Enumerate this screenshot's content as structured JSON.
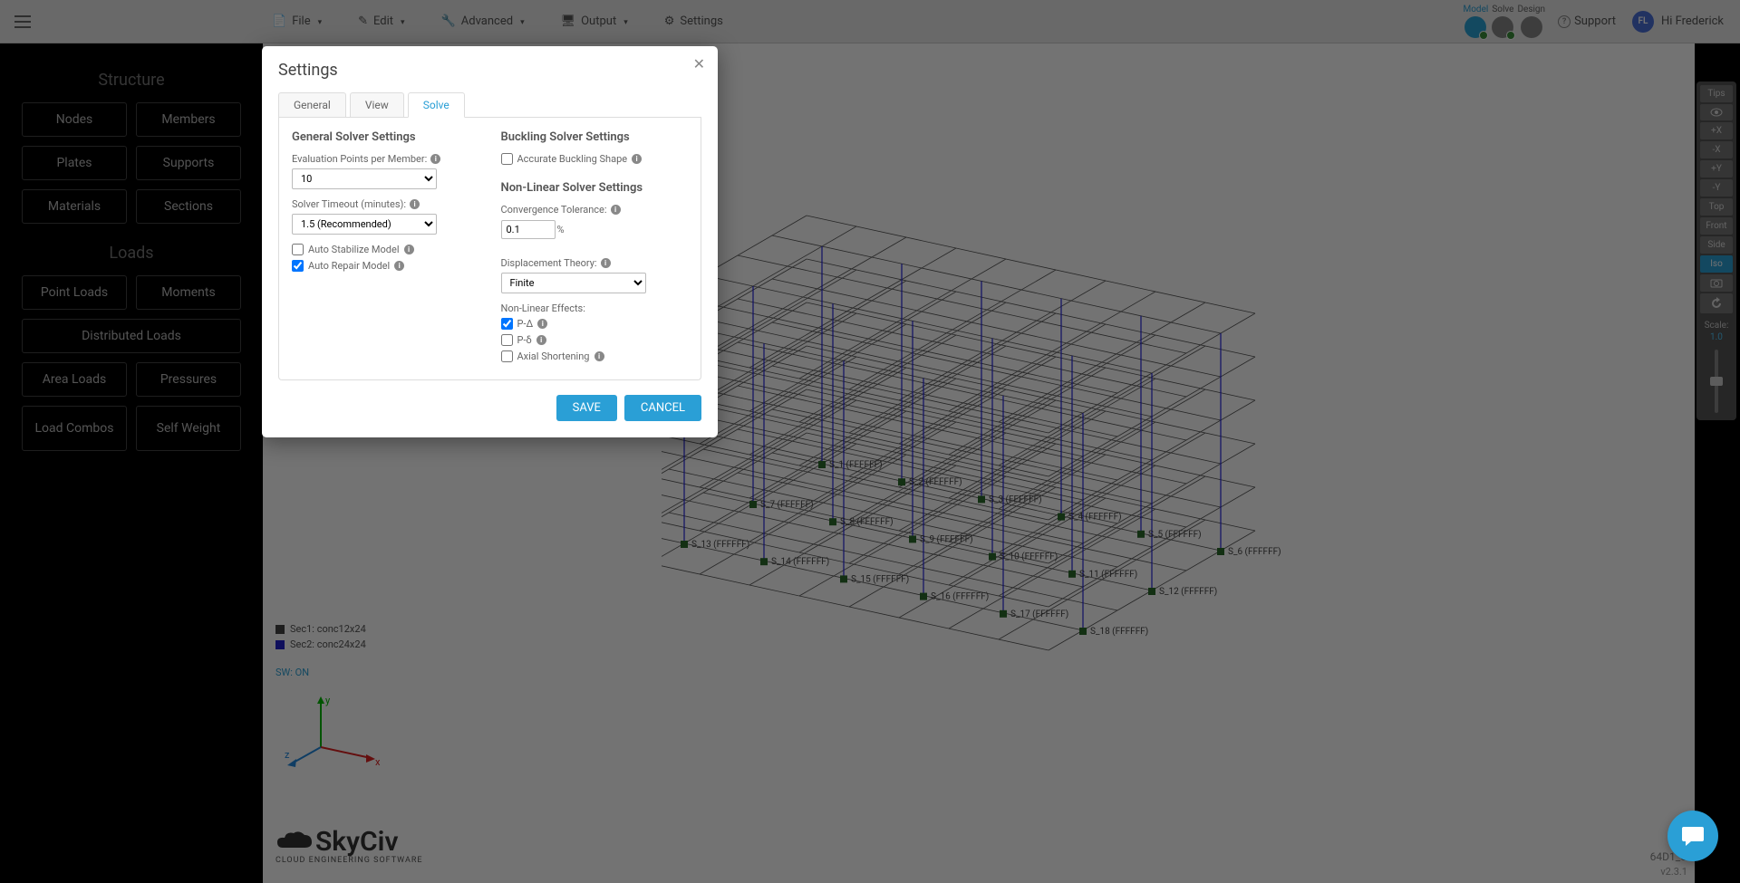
{
  "toolbar": {
    "menus": {
      "file": "File",
      "edit": "Edit",
      "advanced": "Advanced",
      "output": "Output",
      "settings": "Settings"
    },
    "modes": {
      "model": "Model",
      "solve": "Solve",
      "design": "Design"
    },
    "support": "Support",
    "user_greeting": "Hi Frederick",
    "user_initials": "FL"
  },
  "sidebar": {
    "structure_heading": "Structure",
    "loads_heading": "Loads",
    "structure_buttons": [
      "Nodes",
      "Members",
      "Plates",
      "Supports",
      "Materials",
      "Sections"
    ],
    "loads_buttons_row1": [
      "Point Loads",
      "Moments"
    ],
    "loads_distributed": "Distributed Loads",
    "loads_row3": [
      "Area Loads",
      "Pressures"
    ],
    "loads_row4": [
      "Load Combos",
      "Self Weight"
    ]
  },
  "view_controls": {
    "buttons": [
      "Tips",
      "+X",
      "-X",
      "+Y",
      "-Y",
      "Top",
      "Front",
      "Side",
      "Iso"
    ],
    "scale_label": "Scale:",
    "scale_value": "1.0"
  },
  "viewport": {
    "legend": [
      {
        "color": "#444444",
        "label": "Sec1: conc12x24"
      },
      {
        "color": "#2222cc",
        "label": "Sec2: conc24x24"
      }
    ],
    "sw_status": "SW: ON",
    "axes": {
      "x": "x",
      "y": "y",
      "z": "z"
    },
    "logo_text": "SkyCiv",
    "logo_sub": "CLOUD ENGINEERING SOFTWARE",
    "version": "v2.3.1",
    "project_id": "64D1_C",
    "node_labels": [
      "S_1 (FFFFFF)",
      "S_2 (FFFFFF)",
      "S_3 (FFFFFF)",
      "S_4 (FFFFFF)",
      "S_5 (FFFFFF)",
      "S_6 (FFFFFF)",
      "S_7 (FFFFFF)",
      "S_8 (FFFFFF)",
      "S_9 (FFFFFF)",
      "S_10 (FFFFFF)",
      "S_11 (FFFFFF)",
      "S_12 (FFFFFF)",
      "S_13 (FFFFFF)",
      "S_14 (FFFFFF)",
      "S_15 (FFFFFF)",
      "S_16 (FFFFFF)",
      "S_17 (FFFFFF)",
      "S_18 (FFFFFF)"
    ]
  },
  "modal": {
    "title": "Settings",
    "tabs": {
      "general": "General",
      "view": "View",
      "solve": "Solve"
    },
    "general_heading": "General Solver Settings",
    "eval_points_label": "Evaluation Points per Member:",
    "eval_points_value": "10",
    "solver_timeout_label": "Solver Timeout (minutes):",
    "solver_timeout_value": "1.5 (Recommended)",
    "auto_stabilize": "Auto Stabilize Model",
    "auto_repair": "Auto Repair Model",
    "buckling_heading": "Buckling Solver Settings",
    "accurate_buckling": "Accurate Buckling Shape",
    "nonlinear_heading": "Non-Linear Solver Settings",
    "convergence_label": "Convergence Tolerance:",
    "convergence_value": "0.1",
    "convergence_unit": "%",
    "displacement_label": "Displacement Theory:",
    "displacement_value": "Finite",
    "nonlinear_effects_label": "Non-Linear Effects:",
    "p_delta_cap": "P-Δ",
    "p_delta_small": "P-δ",
    "axial_shortening": "Axial Shortening",
    "save": "SAVE",
    "cancel": "CANCEL"
  }
}
